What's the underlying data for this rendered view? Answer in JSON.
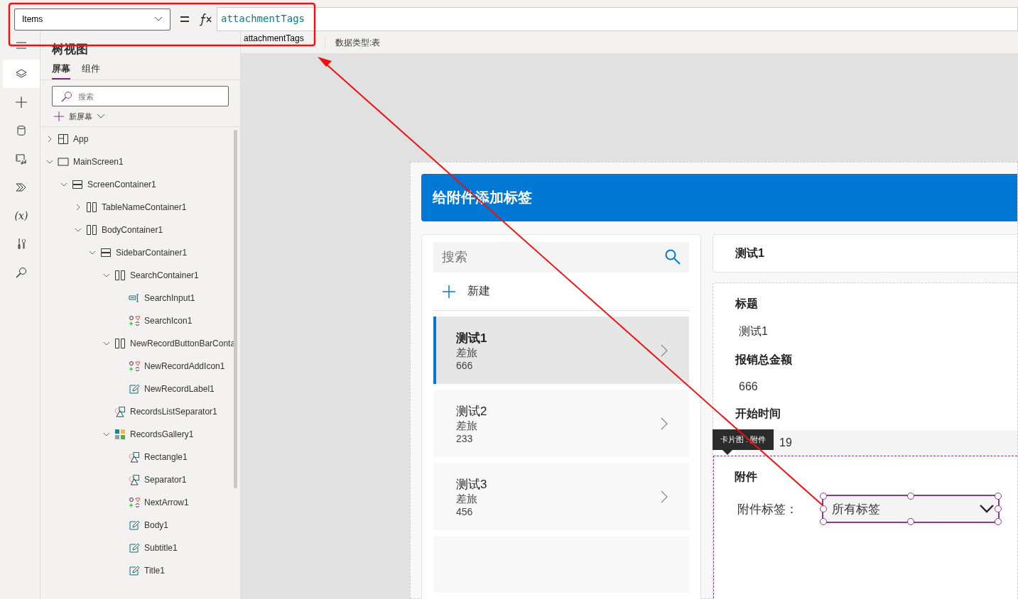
{
  "property_selector": {
    "value": "Items"
  },
  "formula": {
    "text": "attachmentTags"
  },
  "formula_result": {
    "name": "attachmentTags",
    "data_type": "数据类型:表"
  },
  "rail": [
    {
      "kind": "menu",
      "selected": false
    },
    {
      "kind": "layers",
      "selected": true
    },
    {
      "kind": "plus",
      "selected": false
    },
    {
      "kind": "database",
      "selected": false
    },
    {
      "kind": "media",
      "selected": false
    },
    {
      "kind": "flow",
      "selected": false
    },
    {
      "kind": "variables",
      "glyph": "(x)",
      "selected": false
    },
    {
      "kind": "tools",
      "selected": false
    },
    {
      "kind": "search",
      "selected": false
    }
  ],
  "tree_panel": {
    "title": "树视图",
    "tabs": [
      {
        "label": "屏幕",
        "selected": true
      },
      {
        "label": "组件",
        "selected": false
      }
    ],
    "search": {
      "placeholder": "搜索"
    },
    "new_screen": "新屏幕",
    "items": [
      {
        "kind": "app",
        "label": "App",
        "expanded": false
      },
      {
        "kind": "screen",
        "label": "MainScreen1",
        "expanded": true,
        "children": [
          {
            "kind": "vcontainer",
            "label": "ScreenContainer1",
            "expanded": true,
            "children": [
              {
                "kind": "hcontainer",
                "label": "TableNameContainer1",
                "expanded": false
              },
              {
                "kind": "hcontainer",
                "label": "BodyContainer1",
                "expanded": true,
                "children": [
                  {
                    "kind": "vcontainer",
                    "label": "SidebarContainer1",
                    "expanded": true,
                    "children": [
                      {
                        "kind": "hcontainer",
                        "label": "SearchContainer1",
                        "expanded": true,
                        "children": [
                          {
                            "kind": "input",
                            "label": "SearchInput1"
                          },
                          {
                            "kind": "icon",
                            "label": "SearchIcon1"
                          }
                        ]
                      },
                      {
                        "kind": "hcontainer",
                        "label": "NewRecordButtonBarConta",
                        "expanded": true,
                        "children": [
                          {
                            "kind": "icon",
                            "label": "NewRecordAddIcon1"
                          },
                          {
                            "kind": "label",
                            "label": "NewRecordLabel1"
                          }
                        ]
                      },
                      {
                        "kind": "shape",
                        "label": "RecordsListSeparator1"
                      },
                      {
                        "kind": "gallery",
                        "label": "RecordsGallery1",
                        "expanded": true,
                        "children": [
                          {
                            "kind": "shape",
                            "label": "Rectangle1"
                          },
                          {
                            "kind": "shape",
                            "label": "Separator1"
                          },
                          {
                            "kind": "icon",
                            "label": "NextArrow1"
                          },
                          {
                            "kind": "label",
                            "label": "Body1"
                          },
                          {
                            "kind": "label",
                            "label": "Subtitle1"
                          },
                          {
                            "kind": "label",
                            "label": "Title1"
                          }
                        ]
                      }
                    ]
                  }
                ]
              }
            ]
          }
        ]
      }
    ]
  },
  "app": {
    "header": "给附件添加标签",
    "search": {
      "placeholder": "搜索"
    },
    "new_label": "新建",
    "records": [
      {
        "title": "测试1",
        "subtitle": "差旅",
        "body": "666",
        "selected": true
      },
      {
        "title": "测试2",
        "subtitle": "差旅",
        "body": "233",
        "selected": false
      },
      {
        "title": "测试3",
        "subtitle": "差旅",
        "body": "456",
        "selected": false
      }
    ],
    "detail_title": "测试1",
    "fields": [
      {
        "label": "标题",
        "value": "测试1"
      },
      {
        "label": "报销总金额",
        "value": "666"
      },
      {
        "label": "开始时间",
        "value": "19"
      }
    ],
    "tooltip": "卡片图 : 附件",
    "attachment_card": {
      "title": "附件",
      "tag_label": "附件标签：",
      "dropdown": {
        "value": "所有标签",
        "selected": true
      }
    }
  }
}
